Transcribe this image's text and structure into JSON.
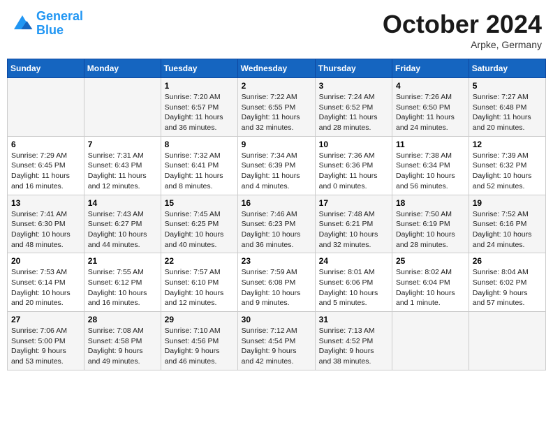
{
  "header": {
    "logo_line1": "General",
    "logo_line2": "Blue",
    "month": "October 2024",
    "location": "Arpke, Germany"
  },
  "weekdays": [
    "Sunday",
    "Monday",
    "Tuesday",
    "Wednesday",
    "Thursday",
    "Friday",
    "Saturday"
  ],
  "weeks": [
    [
      {
        "day": "",
        "info": ""
      },
      {
        "day": "",
        "info": ""
      },
      {
        "day": "1",
        "info": "Sunrise: 7:20 AM\nSunset: 6:57 PM\nDaylight: 11 hours\nand 36 minutes."
      },
      {
        "day": "2",
        "info": "Sunrise: 7:22 AM\nSunset: 6:55 PM\nDaylight: 11 hours\nand 32 minutes."
      },
      {
        "day": "3",
        "info": "Sunrise: 7:24 AM\nSunset: 6:52 PM\nDaylight: 11 hours\nand 28 minutes."
      },
      {
        "day": "4",
        "info": "Sunrise: 7:26 AM\nSunset: 6:50 PM\nDaylight: 11 hours\nand 24 minutes."
      },
      {
        "day": "5",
        "info": "Sunrise: 7:27 AM\nSunset: 6:48 PM\nDaylight: 11 hours\nand 20 minutes."
      }
    ],
    [
      {
        "day": "6",
        "info": "Sunrise: 7:29 AM\nSunset: 6:45 PM\nDaylight: 11 hours\nand 16 minutes."
      },
      {
        "day": "7",
        "info": "Sunrise: 7:31 AM\nSunset: 6:43 PM\nDaylight: 11 hours\nand 12 minutes."
      },
      {
        "day": "8",
        "info": "Sunrise: 7:32 AM\nSunset: 6:41 PM\nDaylight: 11 hours\nand 8 minutes."
      },
      {
        "day": "9",
        "info": "Sunrise: 7:34 AM\nSunset: 6:39 PM\nDaylight: 11 hours\nand 4 minutes."
      },
      {
        "day": "10",
        "info": "Sunrise: 7:36 AM\nSunset: 6:36 PM\nDaylight: 11 hours\nand 0 minutes."
      },
      {
        "day": "11",
        "info": "Sunrise: 7:38 AM\nSunset: 6:34 PM\nDaylight: 10 hours\nand 56 minutes."
      },
      {
        "day": "12",
        "info": "Sunrise: 7:39 AM\nSunset: 6:32 PM\nDaylight: 10 hours\nand 52 minutes."
      }
    ],
    [
      {
        "day": "13",
        "info": "Sunrise: 7:41 AM\nSunset: 6:30 PM\nDaylight: 10 hours\nand 48 minutes."
      },
      {
        "day": "14",
        "info": "Sunrise: 7:43 AM\nSunset: 6:27 PM\nDaylight: 10 hours\nand 44 minutes."
      },
      {
        "day": "15",
        "info": "Sunrise: 7:45 AM\nSunset: 6:25 PM\nDaylight: 10 hours\nand 40 minutes."
      },
      {
        "day": "16",
        "info": "Sunrise: 7:46 AM\nSunset: 6:23 PM\nDaylight: 10 hours\nand 36 minutes."
      },
      {
        "day": "17",
        "info": "Sunrise: 7:48 AM\nSunset: 6:21 PM\nDaylight: 10 hours\nand 32 minutes."
      },
      {
        "day": "18",
        "info": "Sunrise: 7:50 AM\nSunset: 6:19 PM\nDaylight: 10 hours\nand 28 minutes."
      },
      {
        "day": "19",
        "info": "Sunrise: 7:52 AM\nSunset: 6:16 PM\nDaylight: 10 hours\nand 24 minutes."
      }
    ],
    [
      {
        "day": "20",
        "info": "Sunrise: 7:53 AM\nSunset: 6:14 PM\nDaylight: 10 hours\nand 20 minutes."
      },
      {
        "day": "21",
        "info": "Sunrise: 7:55 AM\nSunset: 6:12 PM\nDaylight: 10 hours\nand 16 minutes."
      },
      {
        "day": "22",
        "info": "Sunrise: 7:57 AM\nSunset: 6:10 PM\nDaylight: 10 hours\nand 12 minutes."
      },
      {
        "day": "23",
        "info": "Sunrise: 7:59 AM\nSunset: 6:08 PM\nDaylight: 10 hours\nand 9 minutes."
      },
      {
        "day": "24",
        "info": "Sunrise: 8:01 AM\nSunset: 6:06 PM\nDaylight: 10 hours\nand 5 minutes."
      },
      {
        "day": "25",
        "info": "Sunrise: 8:02 AM\nSunset: 6:04 PM\nDaylight: 10 hours\nand 1 minute."
      },
      {
        "day": "26",
        "info": "Sunrise: 8:04 AM\nSunset: 6:02 PM\nDaylight: 9 hours\nand 57 minutes."
      }
    ],
    [
      {
        "day": "27",
        "info": "Sunrise: 7:06 AM\nSunset: 5:00 PM\nDaylight: 9 hours\nand 53 minutes."
      },
      {
        "day": "28",
        "info": "Sunrise: 7:08 AM\nSunset: 4:58 PM\nDaylight: 9 hours\nand 49 minutes."
      },
      {
        "day": "29",
        "info": "Sunrise: 7:10 AM\nSunset: 4:56 PM\nDaylight: 9 hours\nand 46 minutes."
      },
      {
        "day": "30",
        "info": "Sunrise: 7:12 AM\nSunset: 4:54 PM\nDaylight: 9 hours\nand 42 minutes."
      },
      {
        "day": "31",
        "info": "Sunrise: 7:13 AM\nSunset: 4:52 PM\nDaylight: 9 hours\nand 38 minutes."
      },
      {
        "day": "",
        "info": ""
      },
      {
        "day": "",
        "info": ""
      }
    ]
  ]
}
